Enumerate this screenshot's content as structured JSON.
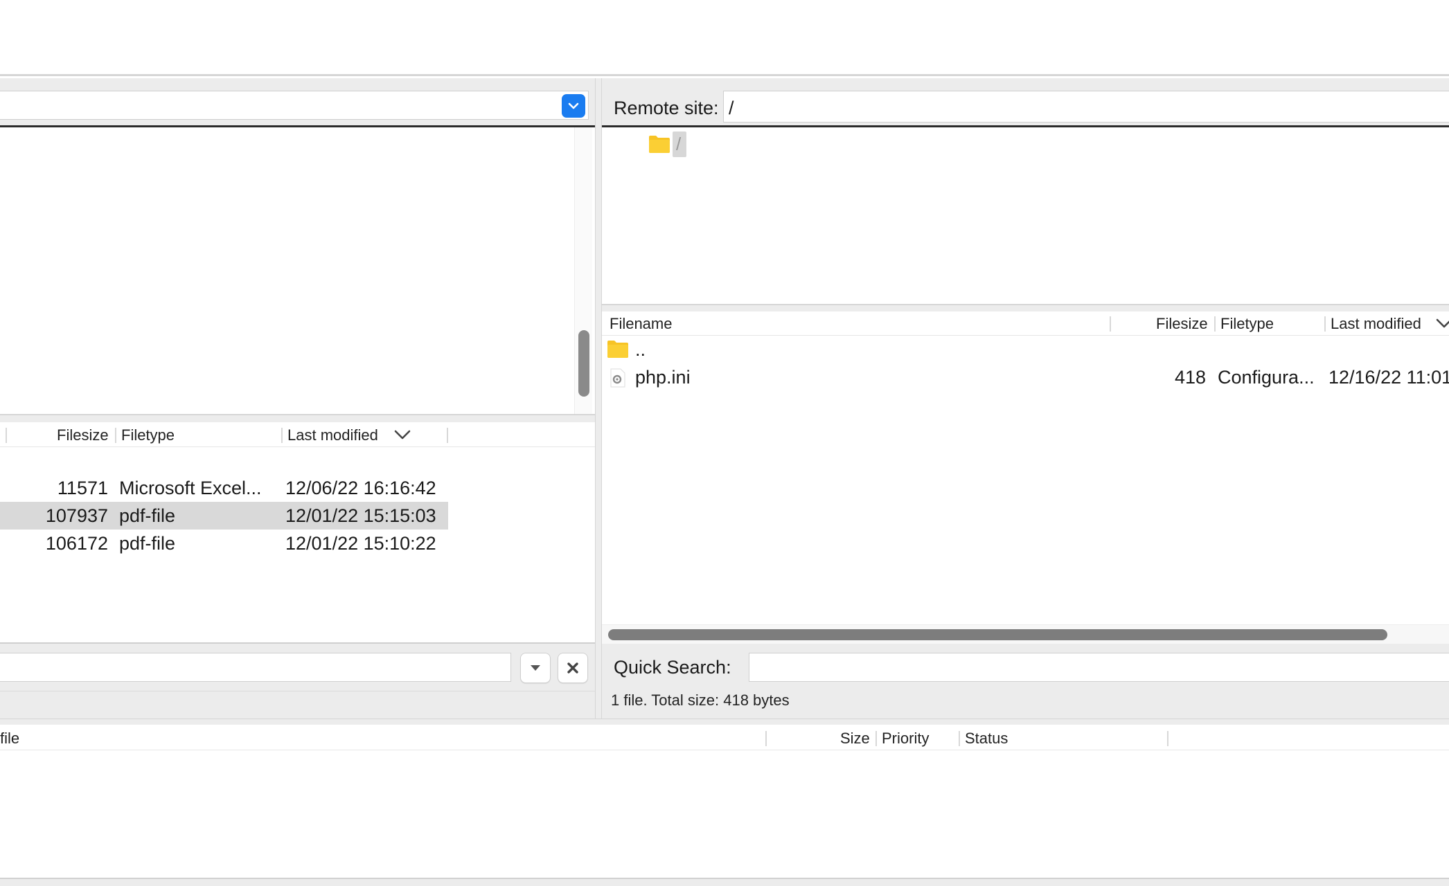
{
  "local": {
    "list": {
      "columns": [
        "Filesize",
        "Filetype",
        "Last modified"
      ],
      "rows": [
        {
          "size": "11571",
          "type": "Microsoft Excel...",
          "modified": "12/06/22 16:16:42",
          "selected": false
        },
        {
          "size": "107937",
          "type": "pdf-file",
          "modified": "12/01/22 15:15:03",
          "selected": true
        },
        {
          "size": "106172",
          "type": "pdf-file",
          "modified": "12/01/22 15:10:22",
          "selected": false
        }
      ]
    }
  },
  "remote": {
    "site_label": "Remote site:",
    "path_value": "/",
    "tree_root": "/",
    "list": {
      "columns": [
        "Filename",
        "Filesize",
        "Filetype",
        "Last modified"
      ],
      "rows": [
        {
          "name": "..",
          "size": "",
          "type": "",
          "modified": "",
          "icon": "folder-icon"
        },
        {
          "name": "php.ini",
          "size": "418",
          "type": "Configura...",
          "modified": "12/16/22 11:01:",
          "icon": "config-file-icon"
        }
      ]
    },
    "quick_search_label": "Quick Search:",
    "status": "1 file. Total size: 418 bytes"
  },
  "queue": {
    "columns": [
      "file",
      "Size",
      "Priority",
      "Status"
    ]
  },
  "colors": {
    "accent": "#1a7cf0",
    "folder": "#f7c325",
    "selection": "#d9d9d9"
  }
}
